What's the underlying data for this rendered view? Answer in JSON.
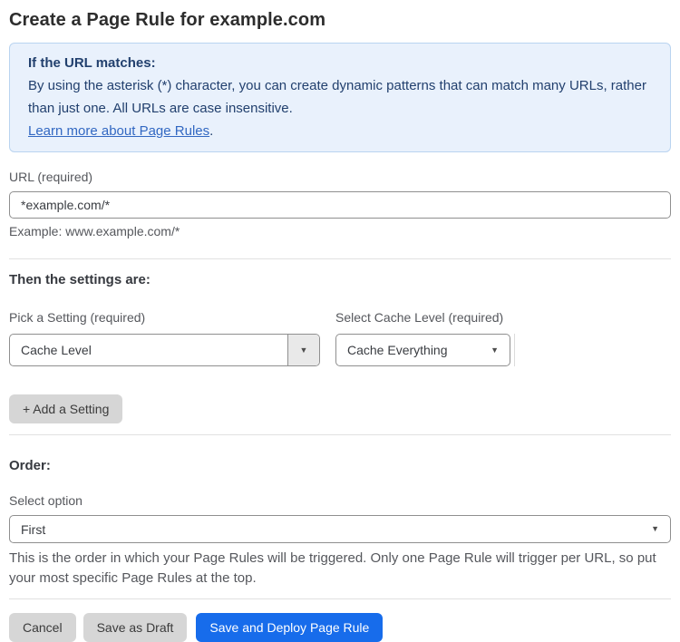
{
  "page": {
    "title": "Create a Page Rule for example.com"
  },
  "info_box": {
    "heading": "If the URL matches:",
    "body": "By using the asterisk (*) character, you can create dynamic patterns that can match many URLs, rather than just one. All URLs are case insensitive.",
    "link_label": "Learn more about Page Rules",
    "link_suffix": "."
  },
  "url_field": {
    "label": "URL (required)",
    "value": "*example.com/*",
    "example": "Example: www.example.com/*"
  },
  "settings": {
    "heading": "Then the settings are:",
    "setting_label": "Pick a Setting (required)",
    "setting_value": "Cache Level",
    "value_label": "Select Cache Level (required)",
    "value_value": "Cache Everything",
    "add_button_label": "+ Add a Setting"
  },
  "order": {
    "heading": "Order:",
    "select_label": "Select option",
    "select_value": "First",
    "help_text": "This is the order in which your Page Rules will be triggered. Only one Page Rule will trigger per URL, so put your most specific Page Rules at the top."
  },
  "footer": {
    "cancel_label": "Cancel",
    "save_draft_label": "Save as Draft",
    "save_deploy_label": "Save and Deploy Page Rule"
  },
  "icons": {
    "dropdown_arrow": "▼"
  },
  "colors": {
    "accent_blue": "#176CEB",
    "info_background": "#E9F1FC",
    "info_border": "#BAD4F0",
    "info_text": "#22406E",
    "link_blue": "#3268C2",
    "button_gray": "#D6D6D6",
    "border_gray": "#8F8F8F"
  }
}
